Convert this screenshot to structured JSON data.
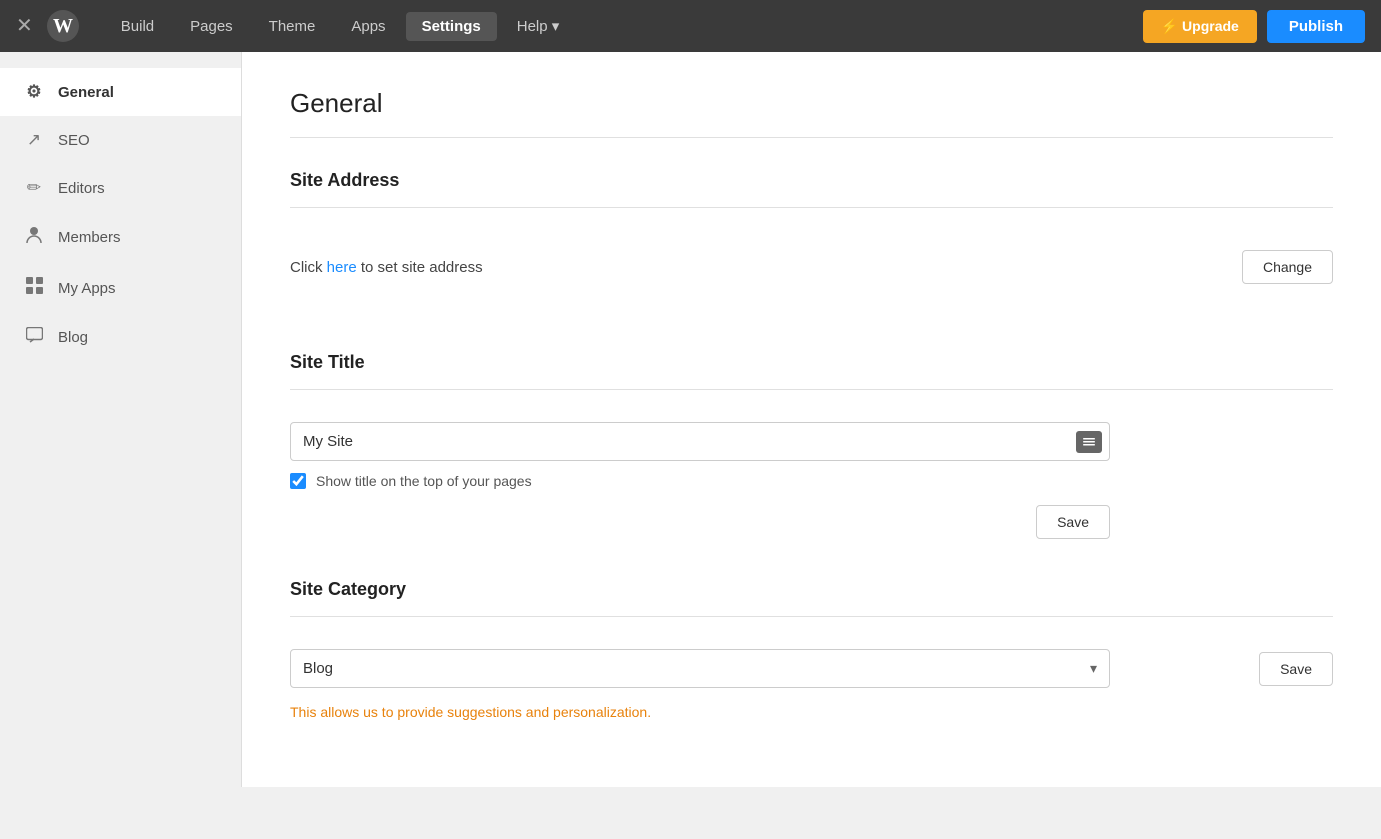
{
  "nav": {
    "close_icon": "×",
    "logo_text": "W",
    "links": [
      {
        "label": "Build",
        "active": false,
        "id": "build"
      },
      {
        "label": "Pages",
        "active": false,
        "id": "pages"
      },
      {
        "label": "Theme",
        "active": false,
        "id": "theme"
      },
      {
        "label": "Apps",
        "active": false,
        "id": "apps"
      },
      {
        "label": "Settings",
        "active": true,
        "id": "settings"
      },
      {
        "label": "Help ▾",
        "active": false,
        "id": "help"
      }
    ],
    "upgrade_label": "⚡ Upgrade",
    "publish_label": "Publish"
  },
  "sidebar": {
    "items": [
      {
        "label": "General",
        "icon": "⚙",
        "active": true,
        "id": "general"
      },
      {
        "label": "SEO",
        "icon": "↗",
        "active": false,
        "id": "seo"
      },
      {
        "label": "Editors",
        "icon": "✏",
        "active": false,
        "id": "editors"
      },
      {
        "label": "Members",
        "icon": "👤",
        "active": false,
        "id": "members"
      },
      {
        "label": "My Apps",
        "icon": "⊞",
        "active": false,
        "id": "myapps"
      },
      {
        "label": "Blog",
        "icon": "💬",
        "active": false,
        "id": "blog"
      }
    ]
  },
  "main": {
    "page_title": "General",
    "sections": {
      "site_address": {
        "title": "Site Address",
        "click_text": "Click ",
        "here_text": "here",
        "after_text": " to set site address",
        "change_btn": "Change"
      },
      "site_title": {
        "title": "Site Title",
        "input_value": "My Site",
        "checkbox_checked": true,
        "checkbox_label": "Show title on the top of your pages",
        "save_btn": "Save"
      },
      "site_category": {
        "title": "Site Category",
        "selected": "Blog",
        "save_btn": "Save",
        "hint_text": "This allows us to provide suggestions and personalization."
      }
    }
  }
}
